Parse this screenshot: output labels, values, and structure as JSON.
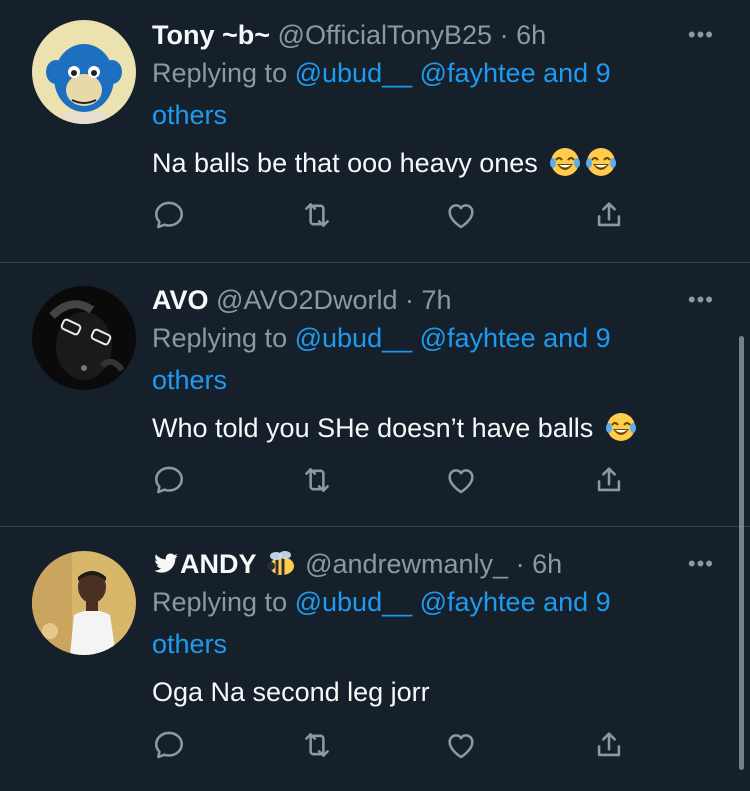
{
  "colors": {
    "background": "#15202b",
    "accent": "#1d9bf0",
    "muted": "#8b98a5",
    "divider": "#38444d"
  },
  "tweets": [
    {
      "name": "Tony ~b~",
      "handle": "@OfficialTonyB25",
      "time": "· 6h",
      "reply_prefix": "Replying to",
      "reply_users": "@ubud__ @fayhtee and 9",
      "reply_others": "others",
      "text": "Na balls be that ooo heavy ones",
      "emoji": "face-with-tears-of-joy x2",
      "more": "•••"
    },
    {
      "name": "AVO",
      "handle": "@AVO2Dworld",
      "time": "· 7h",
      "reply_prefix": "Replying to",
      "reply_users": "@ubud__ @fayhtee and 9",
      "reply_others": "others",
      "text": "Who told you SHe doesn’t have balls",
      "emoji": "face-with-tears-of-joy",
      "more": "•••"
    },
    {
      "name": "ANDY",
      "handle": "@andrewmanly_",
      "time": "· 6h",
      "reply_prefix": "Replying to",
      "reply_users": "@ubud__ @fayhtee and 9",
      "reply_others": "others",
      "text": "Oga Na second leg jorr",
      "name_icons": [
        "twitter-bird-icon",
        "bee-icon"
      ],
      "more": "•••"
    }
  ],
  "action_icons": [
    "reply-icon",
    "retweet-icon",
    "like-icon",
    "share-icon"
  ]
}
